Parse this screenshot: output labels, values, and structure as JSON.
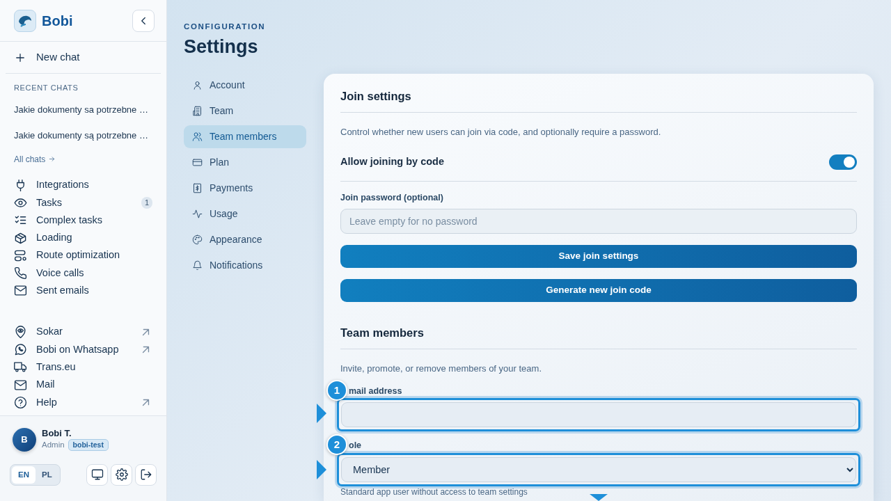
{
  "brand": {
    "name": "Bobi"
  },
  "new_chat": "New chat",
  "recent_chats": {
    "heading": "RECENT CHATS",
    "items": [
      "Jakie dokumenty sa potrzebne …",
      "Jakie dokumenty są potrzebne …"
    ],
    "all_link": "All chats"
  },
  "nav_items": [
    {
      "label": "Integrations"
    },
    {
      "label": "Tasks",
      "badge": "1"
    },
    {
      "label": "Complex tasks"
    },
    {
      "label": "Loading"
    },
    {
      "label": "Route optimization"
    },
    {
      "label": "Voice calls"
    },
    {
      "label": "Sent emails"
    }
  ],
  "links": [
    {
      "label": "Sokar",
      "external": true
    },
    {
      "label": "Bobi on Whatsapp",
      "external": true
    },
    {
      "label": "Trans.eu",
      "external": false
    },
    {
      "label": "Mail",
      "external": false
    },
    {
      "label": "Help",
      "external": true
    }
  ],
  "user": {
    "initial": "B",
    "name": "Bobi T.",
    "role": "Admin",
    "tag": "bobi-test"
  },
  "languages": [
    {
      "label": "EN",
      "selected": true
    },
    {
      "label": "PL",
      "selected": false
    }
  ],
  "page": {
    "eyebrow": "CONFIGURATION",
    "title": "Settings"
  },
  "settings_nav": [
    {
      "label": "Account",
      "selected": false
    },
    {
      "label": "Team",
      "selected": false
    },
    {
      "label": "Team members",
      "selected": true
    },
    {
      "label": "Plan",
      "selected": false
    },
    {
      "label": "Payments",
      "selected": false
    },
    {
      "label": "Usage",
      "selected": false
    },
    {
      "label": "Appearance",
      "selected": false
    },
    {
      "label": "Notifications",
      "selected": false
    }
  ],
  "join_settings": {
    "title": "Join settings",
    "description": "Control whether new users can join via code, and optionally require a password.",
    "toggle": {
      "label": "Allow joining by code",
      "on": true
    },
    "password": {
      "label": "Join password (optional)",
      "placeholder": "Leave empty for no password"
    },
    "buttons": [
      "Save join settings",
      "Generate new join code"
    ]
  },
  "team_members": {
    "title": "Team members",
    "description": "Invite, promote, or remove members of your team.",
    "email": {
      "marker": "1",
      "label": "mail address"
    },
    "role": {
      "marker": "2",
      "label": "ole",
      "value": "Member",
      "hint": "Standard app user without access to team settings"
    }
  }
}
